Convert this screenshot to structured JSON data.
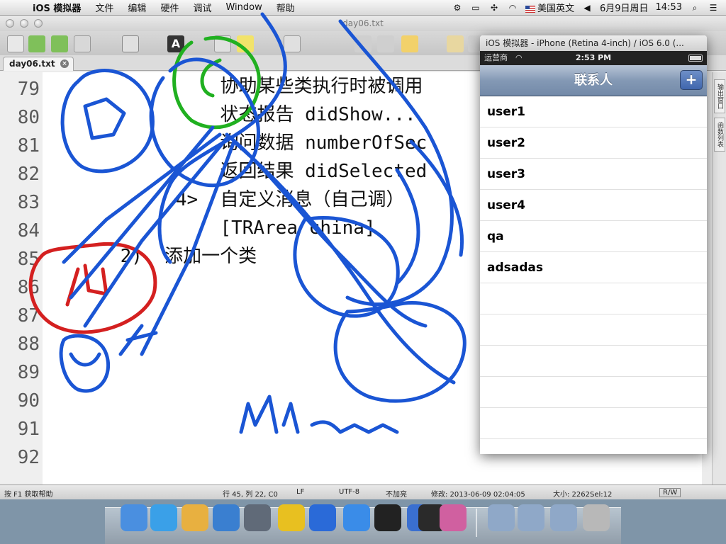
{
  "menubar": {
    "app_name": "iOS 模拟器",
    "items": [
      "文件",
      "编辑",
      "硬件",
      "调试",
      "Window",
      "帮助"
    ],
    "input_source": "美国英文",
    "date": "6月9日周日",
    "time": "14:53"
  },
  "editor": {
    "window_title": "day06.txt",
    "tab_label": "day06.txt",
    "lines": [
      {
        "num": "79",
        "text": "                协助某些类执行时被调用"
      },
      {
        "num": "80",
        "text": "                状态报告 didShow..."
      },
      {
        "num": "81",
        "text": "                询问数据 numberOfSec"
      },
      {
        "num": "82",
        "text": "                返回结果 didSelected"
      },
      {
        "num": "83",
        "text": "            4>  自定义消息（自己调）"
      },
      {
        "num": "84",
        "text": "                [TRArea china]"
      },
      {
        "num": "85",
        "text": "       2)  添加一个类"
      },
      {
        "num": "86",
        "text": ""
      },
      {
        "num": "87",
        "text": ""
      },
      {
        "num": "88",
        "text": ""
      },
      {
        "num": "89",
        "text": ""
      },
      {
        "num": "90",
        "text": ""
      },
      {
        "num": "91",
        "text": ""
      },
      {
        "num": "92",
        "text": ""
      }
    ],
    "side_tabs": [
      "输出窗口",
      "函数列表"
    ]
  },
  "status": {
    "help": "按 F1 获取帮助",
    "position": "行 45, 列 22, C0",
    "line_ending": "LF",
    "encoding": "UTF-8",
    "highlight": "不加亮",
    "modified": "修改: 2013-06-09 02:04:05",
    "size": "大小: 2262Sel:12",
    "mode": "R/W"
  },
  "simulator": {
    "window_title": "iOS 模拟器 - iPhone (Retina 4-inch) / iOS 6.0 (...",
    "carrier": "运营商",
    "time": "2:53 PM",
    "nav_title": "联系人",
    "add_label": "+",
    "contacts": [
      "user1",
      "user2",
      "user3",
      "user4",
      "qa",
      "adsadas",
      "",
      "",
      "",
      "",
      ""
    ]
  },
  "dock": {
    "icons": [
      "finder-icon",
      "safari-icon",
      "pencil-app-icon",
      "blue-app-icon",
      "launchpad-icon",
      "editor-icon",
      "w-app-icon",
      "xcode-icon",
      "terminal-icon",
      "simulator-icon",
      "iphone-icon",
      "script-icon",
      "applications-folder-icon",
      "documents-folder-icon",
      "downloads-folder-icon",
      "trash-icon"
    ]
  },
  "colors": {
    "scribble_blue": "#1a55d4",
    "scribble_red": "#d42020",
    "scribble_green": "#20b020"
  }
}
